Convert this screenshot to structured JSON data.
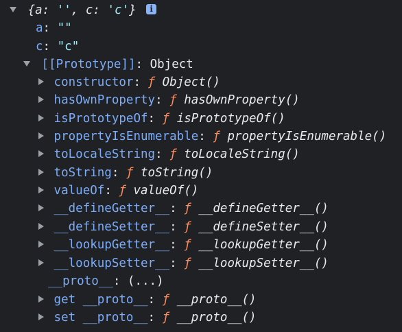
{
  "root": {
    "preview_open": "{",
    "preview_a_key": "a",
    "preview_a_sep": ": ",
    "preview_a_val": "''",
    "preview_comma": ", ",
    "preview_c_key": "c",
    "preview_c_sep": ": ",
    "preview_c_val": "'c'",
    "preview_close": "}",
    "info_icon_glyph": "i"
  },
  "own_props": [
    {
      "key": "a",
      "sep": ": ",
      "value": "\"\""
    },
    {
      "key": "c",
      "sep": ": ",
      "value": "\"c\""
    }
  ],
  "prototype": {
    "label": "[[Prototype]]",
    "sep": ": ",
    "value": "Object"
  },
  "proto_members": [
    {
      "key": "constructor",
      "f": "ƒ",
      "sig": "Object()"
    },
    {
      "key": "hasOwnProperty",
      "f": "ƒ",
      "sig": "hasOwnProperty()"
    },
    {
      "key": "isPrototypeOf",
      "f": "ƒ",
      "sig": "isPrototypeOf()"
    },
    {
      "key": "propertyIsEnumerable",
      "f": "ƒ",
      "sig": "propertyIsEnumerable()"
    },
    {
      "key": "toLocaleString",
      "f": "ƒ",
      "sig": "toLocaleString()"
    },
    {
      "key": "toString",
      "f": "ƒ",
      "sig": "toString()"
    },
    {
      "key": "valueOf",
      "f": "ƒ",
      "sig": "valueOf()"
    },
    {
      "key": "__defineGetter__",
      "f": "ƒ",
      "sig": "__defineGetter__()"
    },
    {
      "key": "__defineSetter__",
      "f": "ƒ",
      "sig": "__defineSetter__()"
    },
    {
      "key": "__lookupGetter__",
      "f": "ƒ",
      "sig": "__lookupGetter__()"
    },
    {
      "key": "__lookupSetter__",
      "f": "ƒ",
      "sig": "__lookupSetter__()"
    }
  ],
  "proto_accessor": {
    "key": "__proto__",
    "sep": ": ",
    "value": "(...)"
  },
  "accessor_fns": [
    {
      "prefix": "get",
      "key": "__proto__",
      "f": "ƒ",
      "sig": "__proto__()"
    },
    {
      "prefix": "set",
      "key": "__proto__",
      "f": "ƒ",
      "sig": "__proto__()"
    }
  ],
  "sep": ": ",
  "colors": {
    "background": "#202124",
    "key": "#7cacf8",
    "string": "#9df2fb",
    "function_f": "#ff8c5a",
    "text": "#e8eaed",
    "triangle": "#9aa0a6"
  }
}
